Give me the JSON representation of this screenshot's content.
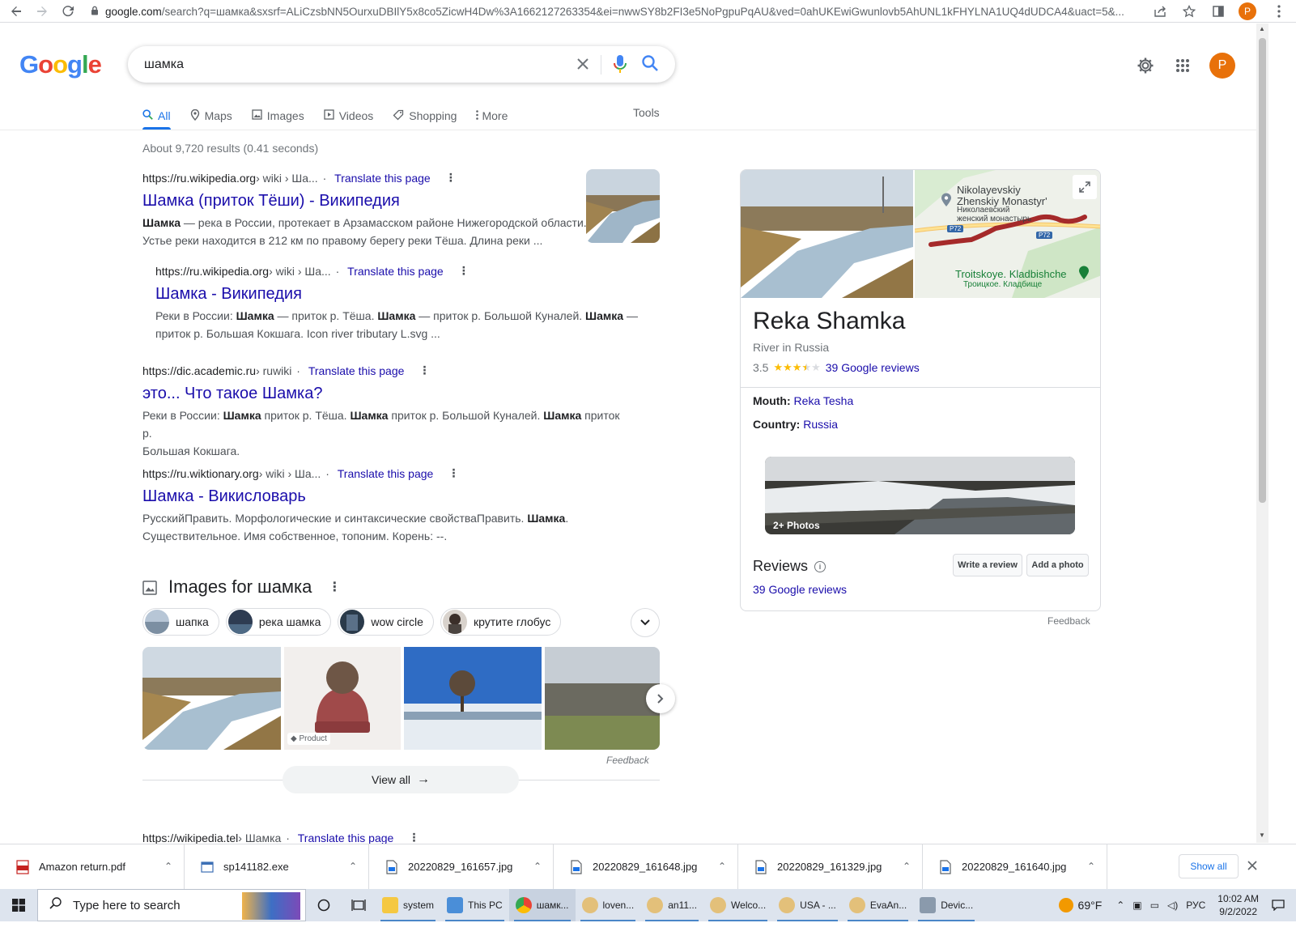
{
  "browser": {
    "url_host": "google.com",
    "url_rest": "/search?q=шамка&sxsrf=ALiCzsbNN5OurxuDBIlY5x8co5ZicwH4Dw%3A1662127263354&ei=nwwSY8b2FI3e5NoPgpuPqAU&ved=0ahUKEwiGwunlovb5AhUNL1kFHYLNA1UQ4dUDCA4&uact=5&...",
    "profile_initial": "P"
  },
  "search": {
    "query": "шамка"
  },
  "header": {
    "avatar_initial": "P"
  },
  "tabs": [
    {
      "label": "All",
      "icon": "search-icon",
      "active": true
    },
    {
      "label": "Maps",
      "icon": "map-pin-icon"
    },
    {
      "label": "Images",
      "icon": "image-icon"
    },
    {
      "label": "Videos",
      "icon": "video-icon"
    },
    {
      "label": "Shopping",
      "icon": "tag-icon"
    },
    {
      "label": "More",
      "icon": "kebab-icon"
    }
  ],
  "tools_label": "Tools",
  "result_stats": "About 9,720 results (0.41 seconds)",
  "translate_label": "Translate this page",
  "results": [
    {
      "site": "https://ru.wikipedia.org",
      "path": " › wiki › Ша...",
      "title": "Шамка (приток Тёши) - Википедия",
      "snippet_bold": "Шамка",
      "snippet_1": " — река в России, протекает в Арзамасском районе Нижегородской области.",
      "snippet_2": "Устье реки находится в 212 км по правому берегу реки Тёша. Длина реки ..."
    },
    {
      "site": "https://ru.wikipedia.org",
      "path": " › wiki › Ша...",
      "title": "Шамка - Википедия",
      "snippet_a": "Реки в России: ",
      "snippet_b": "Шамка",
      "snippet_c": " — приток р. Тёша. ",
      "snippet_d": "Шамка",
      "snippet_e": " — приток р. Большой Куналей. ",
      "snippet_f": "Шамка",
      "snippet_g": " —",
      "snippet_2": "приток р. Большая Кокшага. Icon river tributary L.svg ..."
    },
    {
      "site": "https://dic.academic.ru",
      "path": " › ruwiki",
      "title": "это... Что такое Шамка?",
      "snippet_a": "Реки в России: ",
      "snippet_b": "Шамка",
      "snippet_c": " приток р. Тёша. ",
      "snippet_d": "Шамка",
      "snippet_e": " приток р. Большой Куналей. ",
      "snippet_f": "Шамка",
      "snippet_g": " приток р.",
      "snippet_2": "Большая Кокшага."
    },
    {
      "site": "https://ru.wiktionary.org",
      "path": " › wiki › Ша...",
      "title": "Шамка - Викисловарь",
      "snippet_a": "РусскийПравить. Морфологические и синтаксические свойстваПравить. ",
      "snippet_b": "Шамка",
      "snippet_c": ".",
      "snippet_2": "Существительное. Имя собственное, топоним. Корень: --."
    },
    {
      "site": "https://wikipedia.tel",
      "path": " › Шамка"
    }
  ],
  "images_section": {
    "title": "Images for шамка",
    "chips": [
      "шапка",
      "река шамка",
      "wow circle",
      "крутите глобус"
    ],
    "product_badge": "Product",
    "feedback": "Feedback",
    "view_all": "View all"
  },
  "knowledge_panel": {
    "title": "Reka Shamka",
    "subtitle": "River in Russia",
    "rating": "3.5",
    "rating_value": 3.5,
    "reviews_link": "39 Google reviews",
    "mouth_label": "Mouth:",
    "mouth_value": "Reka Tesha",
    "country_label": "Country:",
    "country_value": "Russia",
    "photos_label": "2+ Photos",
    "reviews_heading": "Reviews",
    "write_review": "Write a review",
    "add_photo": "Add a photo",
    "reviews_link_2": "39 Google reviews",
    "feedback": "Feedback",
    "map": {
      "label_1a": "Nikolayevskiy",
      "label_1b": "Zhenskiy Monastyr'",
      "label_1c": "Николаевский",
      "label_1d": "женский монастырь",
      "road_1": "P72",
      "road_2": "P72",
      "label_2a": "Troitskoye. Kladbishche",
      "label_2b": "Троицкое. Кладбище"
    }
  },
  "downloads": {
    "items": [
      "Amazon return.pdf",
      "sp141182.exe",
      "20220829_161657.jpg",
      "20220829_161648.jpg",
      "20220829_161329.jpg",
      "20220829_161640.jpg"
    ],
    "pdf_badge": "PDF",
    "show_all": "Show all"
  },
  "taskbar": {
    "search_placeholder": "Type here to search",
    "apps": [
      "system",
      "This PC",
      "шамк...",
      "loven...",
      "an11...",
      "Welco...",
      "USA - ...",
      "EvaAn...",
      "Devic..."
    ],
    "weather": "69°F",
    "language": "РУС",
    "time": "10:02 AM",
    "date": "9/2/2022"
  },
  "colors": {
    "link": "#1a0dab",
    "accent": "#1a73e8",
    "star": "#fbbc04",
    "avatar": "#e8710a"
  }
}
